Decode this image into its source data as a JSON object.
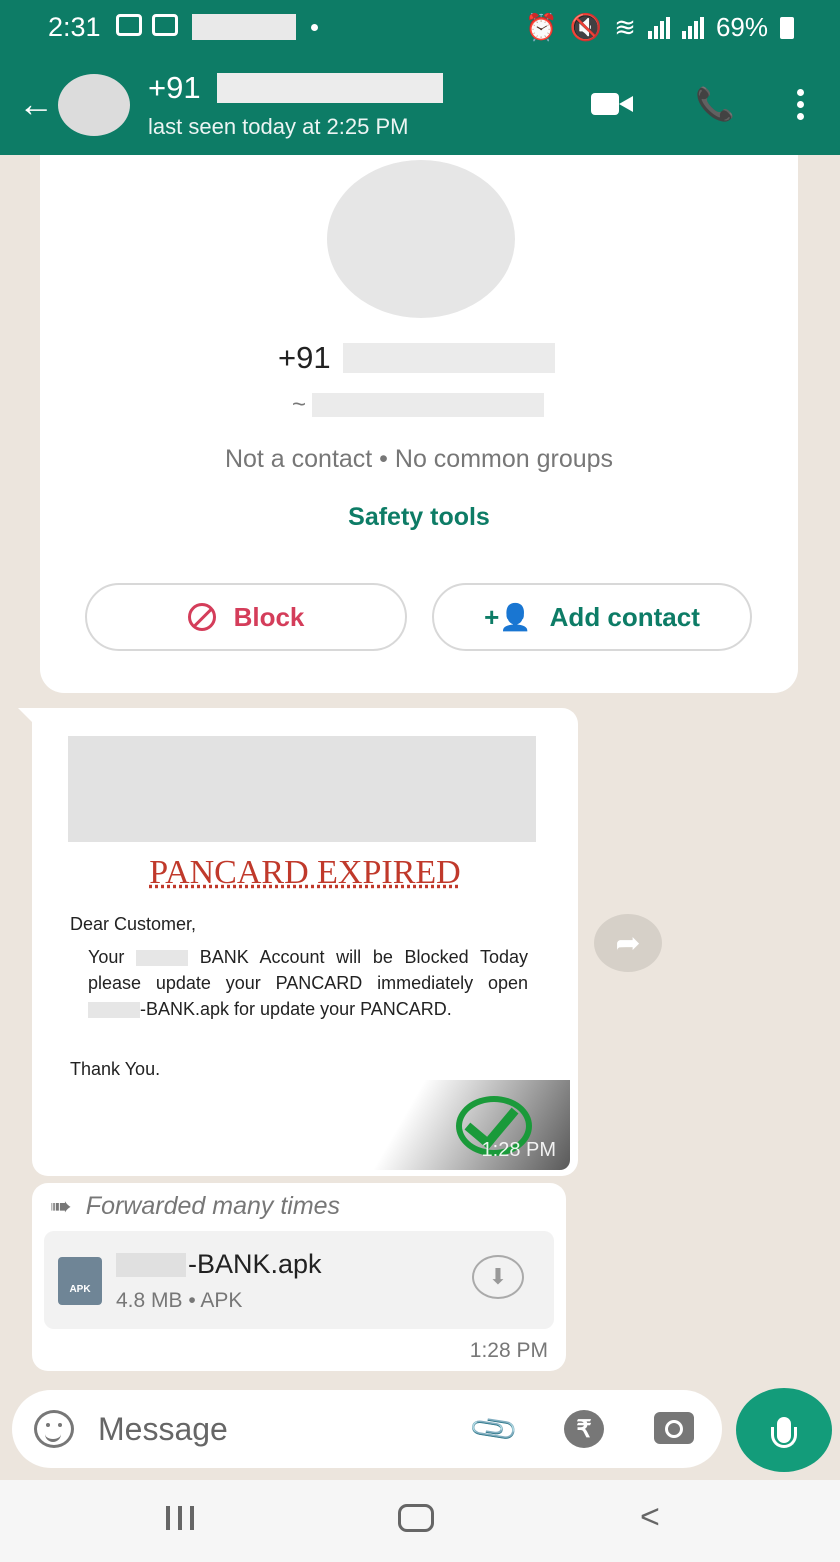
{
  "status_bar": {
    "time": "2:31",
    "battery": "69%"
  },
  "header": {
    "contact_prefix": "+91",
    "last_seen": "last seen today at 2:25 PM"
  },
  "contact_card": {
    "phone_prefix": "+91",
    "nickname_prefix": "~",
    "info": "Not a contact • No common groups",
    "safety_tools": "Safety tools",
    "block_label": "Block",
    "add_contact_label": "Add contact"
  },
  "image_message": {
    "title": "PANCARD EXPIRED",
    "greeting": "Dear Customer,",
    "body_1": "Your",
    "body_2": "BANK Account will be Blocked Today please update your PANCARD immediately open",
    "body_3": "-BANK.apk for update your PANCARD.",
    "closing": "Thank You.",
    "time": "1:28 PM"
  },
  "file_message": {
    "forwarded": "Forwarded many times",
    "file_name": "-BANK.apk",
    "file_meta": "4.8 MB • APK",
    "file_icon_text": "APK",
    "time": "1:28 PM"
  },
  "input": {
    "placeholder": "Message"
  },
  "colors": {
    "header": "#0d7c66",
    "chat_bg": "#ece5dd",
    "accent": "#139c7a",
    "block": "#d43d5a"
  }
}
